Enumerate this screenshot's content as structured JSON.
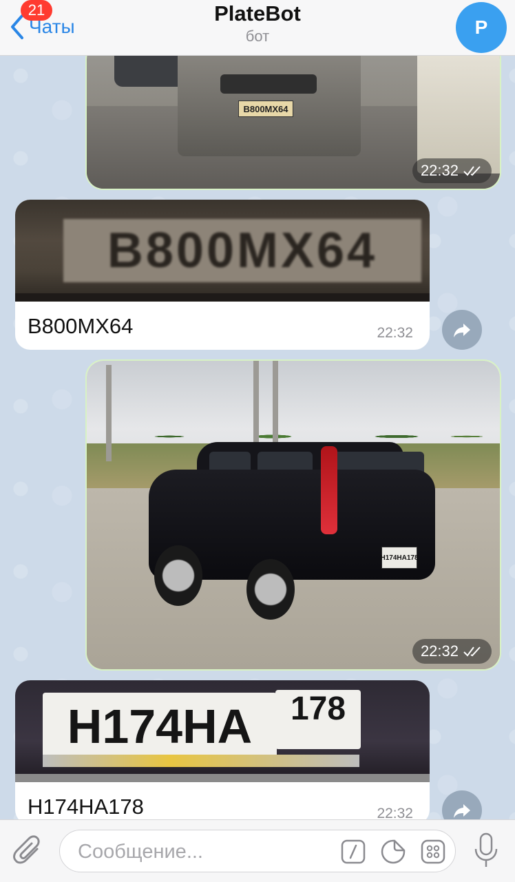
{
  "header": {
    "back_label": "Чаты",
    "unread_count": "21",
    "title": "PlateBot",
    "subtitle": "бот",
    "avatar_letter": "P"
  },
  "messages": [
    {
      "kind": "photo",
      "time": "22:32",
      "plate_text": "В800МХ64"
    },
    {
      "kind": "bot",
      "caption": "B800MX64",
      "time": "22:32",
      "crop_text": "В800МХ64"
    },
    {
      "kind": "photo",
      "time": "22:32",
      "plate_text": "Н174НА178"
    },
    {
      "kind": "bot",
      "caption": "H174HA178",
      "time": "22:32",
      "crop_main": "Н174НА",
      "crop_region": "178"
    }
  ],
  "input": {
    "placeholder": "Сообщение..."
  },
  "colors": {
    "accent": "#2a86e6",
    "badge": "#ff3b30",
    "avatar": "#3aa0f0",
    "outgoing_border": "#d8f2c4"
  },
  "icons": [
    "chevron-left-icon",
    "paperclip-icon",
    "slash-command-icon",
    "sticker-icon",
    "keyboard-grid-icon",
    "microphone-icon",
    "share-icon",
    "double-check-icon"
  ]
}
